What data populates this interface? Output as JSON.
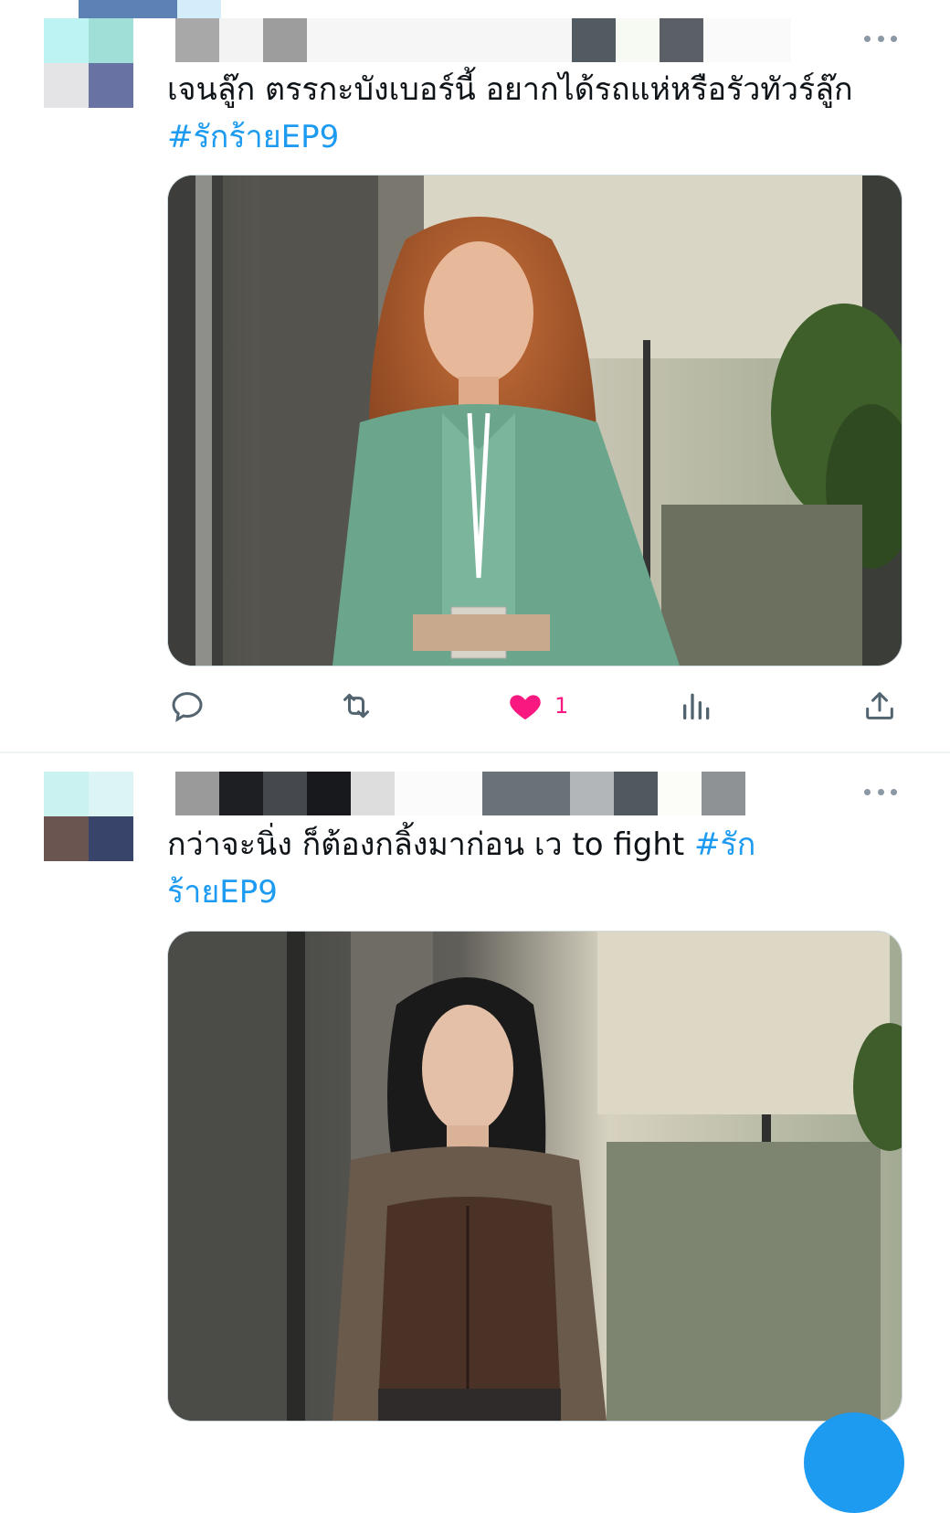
{
  "colors": {
    "accent": "#1d9bf0",
    "like": "#f91880",
    "icon_gray": "#536471",
    "divider": "#eff3f4"
  },
  "tweets": [
    {
      "text": "เจนลู๊ก ตรรกะบังเบอร์นี้ อยากได้รถแห่หรือรัวทัวร์ลู๊ก",
      "hashtag": "#รักร้ายEP9",
      "media_alt": "woman with auburn hair in green tweed jacket",
      "actions": {
        "reply_icon": "reply-icon",
        "retweet_icon": "retweet-icon",
        "like_icon": "heart-filled-icon",
        "like_count": "1",
        "views_icon": "views-icon",
        "share_icon": "share-icon"
      }
    },
    {
      "text_line1": "กว่าจะนิ่ง ก็ต้องกลิ้งมาก่อน  เว to fight ",
      "hashtag_part1": "#รัก",
      "hashtag_part2": "ร้ายEP9",
      "media_alt": "woman with black hair in brown leather corset top"
    }
  ]
}
